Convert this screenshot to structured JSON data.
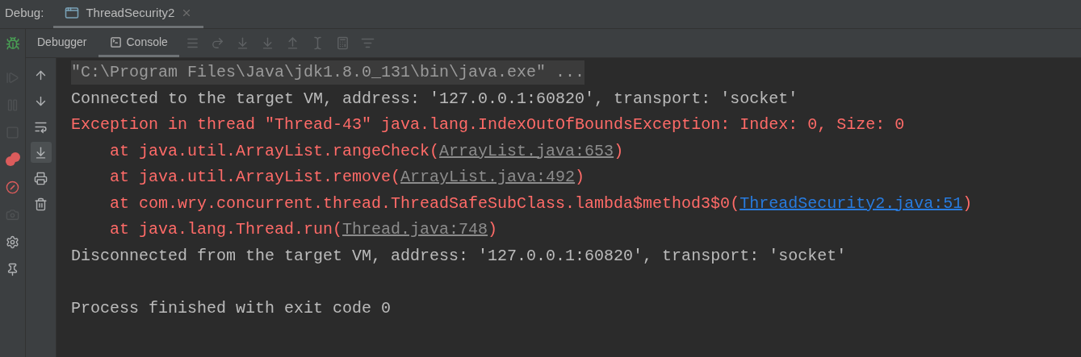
{
  "debug_bar": {
    "label": "Debug:",
    "tabs": [
      {
        "title": "ThreadSecurity2",
        "selected": true
      }
    ]
  },
  "view_tabs": [
    {
      "label": "Debugger",
      "selected": false
    },
    {
      "label": "Console",
      "selected": true
    }
  ],
  "step_actions": [
    {
      "kind": "menu",
      "disabled": true
    },
    {
      "kind": "step-over",
      "disabled": true
    },
    {
      "kind": "step-into",
      "disabled": true
    },
    {
      "kind": "force-step-into",
      "disabled": true
    },
    {
      "kind": "step-out",
      "disabled": true
    },
    {
      "kind": "run-to-cursor",
      "disabled": true
    },
    {
      "kind": "evaluate",
      "disabled": true
    },
    {
      "kind": "trace",
      "disabled": true
    }
  ],
  "debug_actions": [
    {
      "kind": "resume",
      "disabled": true
    },
    {
      "kind": "pause",
      "disabled": true
    },
    {
      "kind": "stop",
      "disabled": true
    },
    {
      "kind": "breakpoints",
      "disabled": false
    },
    {
      "kind": "mute",
      "disabled": false
    },
    {
      "kind": "camera",
      "disabled": true
    },
    {
      "kind": "settings",
      "disabled": false
    },
    {
      "kind": "pin",
      "disabled": false
    }
  ],
  "console_tools": [
    {
      "kind": "up",
      "on": false
    },
    {
      "kind": "down",
      "on": false
    },
    {
      "kind": "wrap",
      "on": false
    },
    {
      "kind": "scroll-end",
      "on": true
    },
    {
      "kind": "print",
      "on": false
    },
    {
      "kind": "clear",
      "on": false
    }
  ],
  "console": {
    "lines": [
      {
        "kind": "command",
        "text": "\"C:\\Program Files\\Java\\jdk1.8.0_131\\bin\\java.exe\" ..."
      },
      {
        "kind": "info",
        "text": "Connected to the target VM, address: '127.0.0.1:60820', transport: 'socket'"
      },
      {
        "kind": "error",
        "text": "Exception in thread \"Thread-43\" java.lang.IndexOutOfBoundsException: Index: 0, Size: 0"
      },
      {
        "kind": "trace",
        "prefix": "at java.util.ArrayList.rangeCheck(",
        "link": "ArrayList.java:653",
        "visited": true,
        "suffix": ")"
      },
      {
        "kind": "trace",
        "prefix": "at java.util.ArrayList.remove(",
        "link": "ArrayList.java:492",
        "visited": true,
        "suffix": ")"
      },
      {
        "kind": "trace",
        "prefix": "at com.wry.concurrent.thread.ThreadSafeSubClass.lambda$method3$0(",
        "link": "ThreadSecurity2.java:51",
        "visited": false,
        "suffix": ")"
      },
      {
        "kind": "trace",
        "prefix": "at java.lang.Thread.run(",
        "link": "Thread.java:748",
        "visited": true,
        "suffix": ")"
      },
      {
        "kind": "info",
        "text": "Disconnected from the target VM, address: '127.0.0.1:60820', transport: 'socket'"
      },
      {
        "kind": "blank"
      },
      {
        "kind": "info",
        "text": "Process finished with exit code 0"
      }
    ]
  }
}
